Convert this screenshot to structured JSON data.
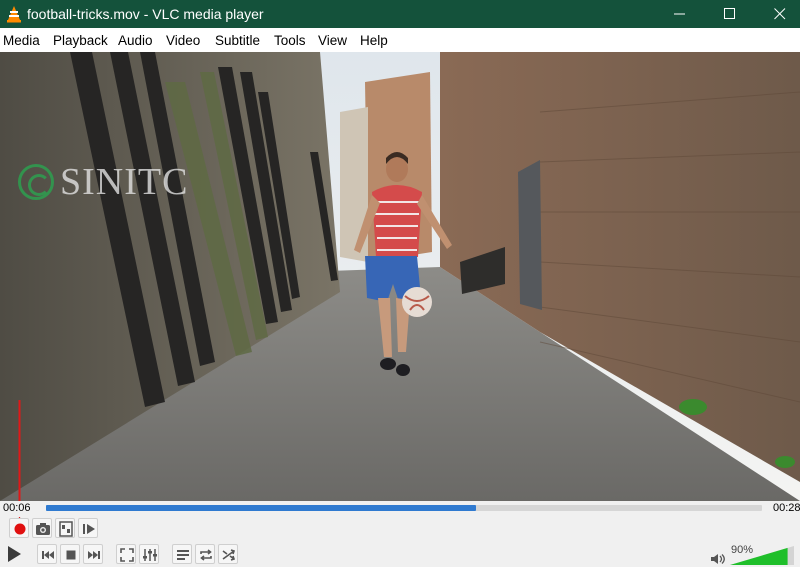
{
  "window": {
    "title": "football-tricks.mov - VLC media player",
    "controls": [
      "minimize",
      "maximize",
      "close"
    ]
  },
  "menu": {
    "items": [
      "Media",
      "Playback",
      "Audio",
      "Video",
      "Subtitle",
      "Tools",
      "View",
      "Help"
    ]
  },
  "video": {
    "watermark": "SINITC"
  },
  "seek": {
    "elapsed": "00:06",
    "total": "00:28",
    "progress": 0.6
  },
  "controls": {
    "row1": [
      "record-icon",
      "snapshot-icon",
      "loop-ab-icon",
      "frame-by-frame-icon"
    ],
    "row2": [
      "play-icon",
      "previous-icon",
      "stop-icon",
      "next-icon",
      "fullscreen-icon",
      "extended-settings-icon",
      "playlist-icon",
      "loop-icon",
      "shuffle-icon"
    ]
  },
  "volume": {
    "label": "90%",
    "level": 0.9
  },
  "colors": {
    "titlebar": "#14523b",
    "seek_fill": "#2f7ad0",
    "record": "#e01010",
    "volume": "#1fbf2a",
    "annotation_arrow": "#e01818"
  }
}
